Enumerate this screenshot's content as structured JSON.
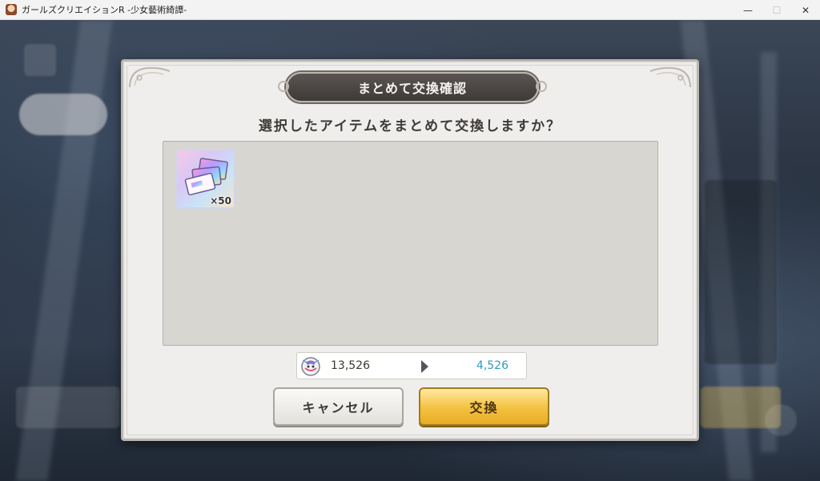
{
  "window": {
    "title": "ガールズクリエイションR -少女藝術綺譚-",
    "minimize_glyph": "—",
    "maximize_glyph": "☐",
    "close_glyph": "✕"
  },
  "dialog": {
    "title": "まとめて交換確認",
    "question": "選択したアイテムをまとめて交換しますか？",
    "items": [
      {
        "icon": "ticket-stack-icon",
        "quantity": "×50"
      }
    ],
    "currency": {
      "icon": "currency-icon",
      "before": "13,526",
      "after": "4,526"
    },
    "buttons": {
      "cancel": "キャンセル",
      "confirm": "交換"
    }
  },
  "colors": {
    "after_value": "#2f9ac4",
    "confirm_button": "#f3c140",
    "title_plate": "#4a4542"
  }
}
